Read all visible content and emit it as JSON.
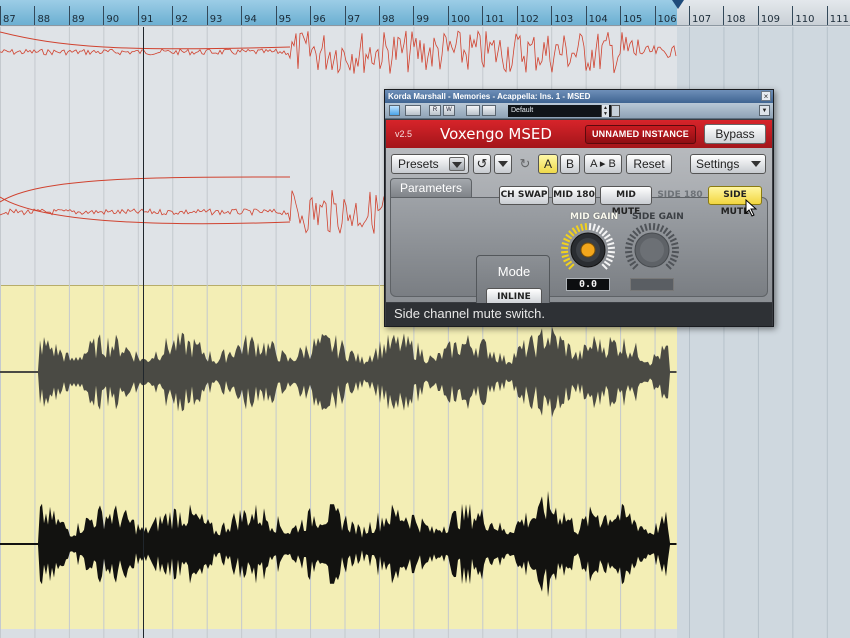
{
  "ruler": {
    "bars": [
      "87",
      "88",
      "89",
      "90",
      "91",
      "92",
      "93",
      "94",
      "95",
      "96",
      "97",
      "98",
      "99",
      "100",
      "101",
      "102",
      "103",
      "104",
      "105",
      "106",
      "107",
      "108",
      "109",
      "110",
      "111"
    ]
  },
  "plugin": {
    "title": "Korda Marshall - Memories - Acappella: Ins. 1 - MSED",
    "close_glyph": "×",
    "host": {
      "preset_value": "Default",
      "btn_r": "R",
      "btn_w": "W"
    },
    "header": {
      "version": "v2.5",
      "product": "Voxengo MSED",
      "instance": "UNNAMED INSTANCE",
      "bypass": "Bypass"
    },
    "toolbar": {
      "presets": "Presets",
      "a": "A",
      "b": "B",
      "atob": "A ▸ B",
      "reset": "Reset",
      "settings": "Settings"
    },
    "parameters_tab": "Parameters",
    "switches": {
      "ch_swap": "CH SWAP",
      "mid_180": "MID 180",
      "mid_mute": "MID MUTE",
      "side_180": "SIDE 180",
      "side_mute": "SIDE MUTE"
    },
    "mode": {
      "label": "Mode",
      "value": "INLINE"
    },
    "mid_gain": {
      "label": "MID GAIN",
      "value": "0.0"
    },
    "side_gain": {
      "label": "SIDE GAIN"
    },
    "status": "Side channel mute switch."
  },
  "colors": {
    "accent_red": "#c81a20",
    "ruler_selected": "#7fbddc",
    "track_audio_bg": "#f3eeb5",
    "waveform_red": "#d0422f",
    "knob_yellow": "#f2d21c"
  }
}
